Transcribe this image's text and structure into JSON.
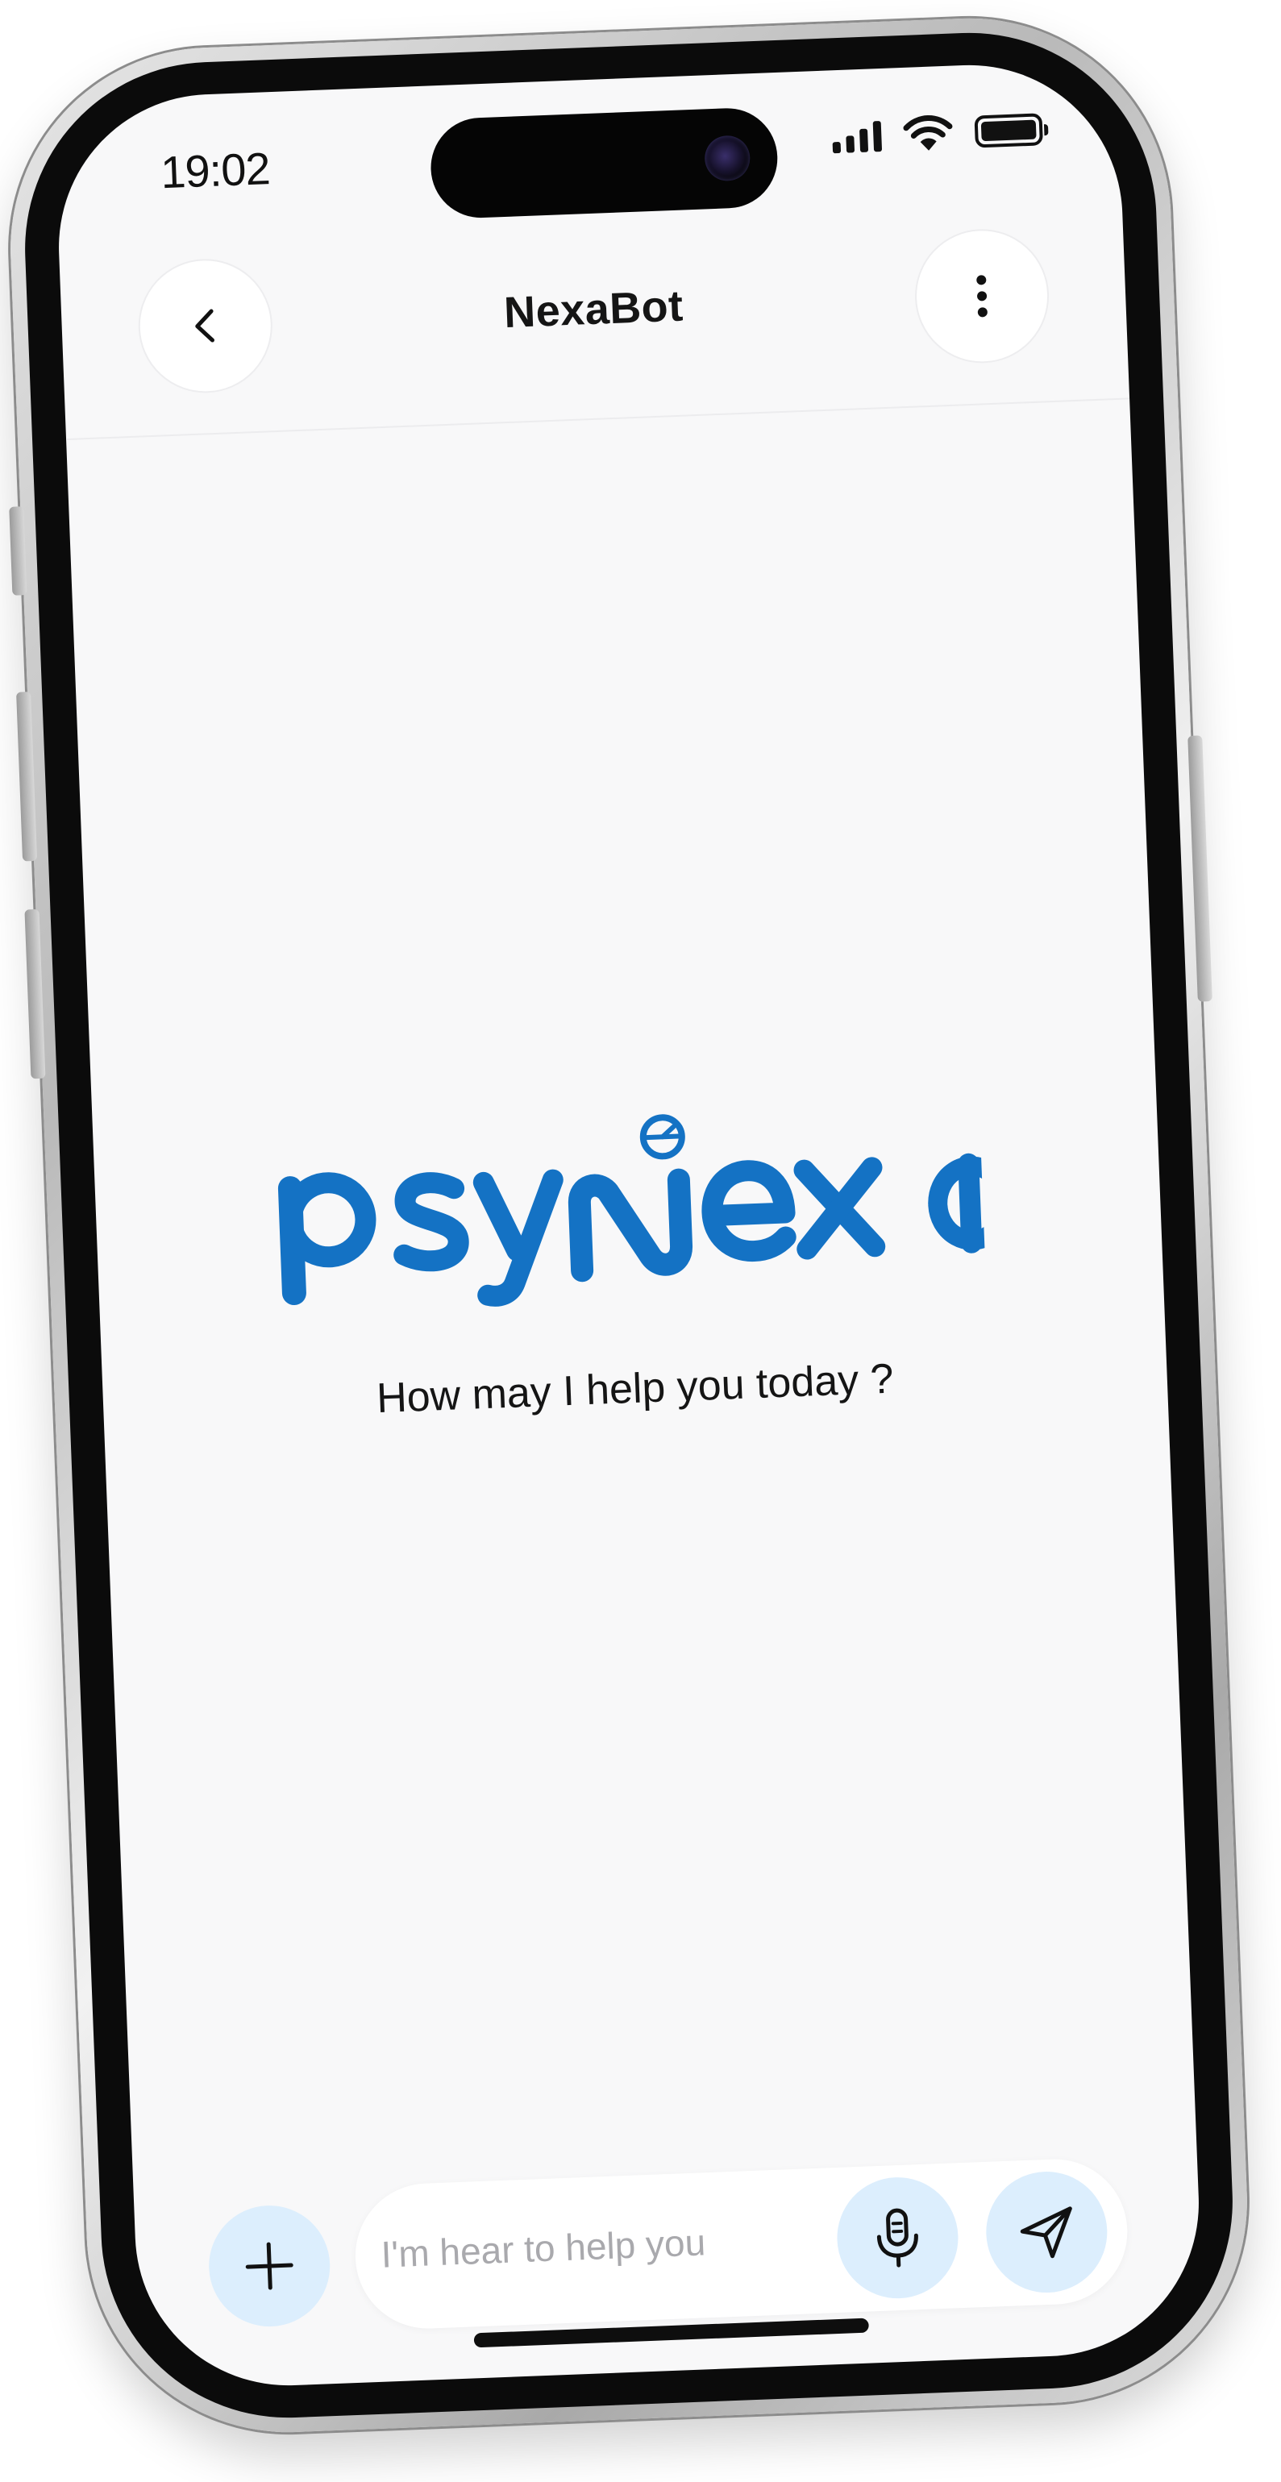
{
  "status_bar": {
    "time": "19:02",
    "icons": [
      "cellular-signal-icon",
      "wifi-icon",
      "battery-icon"
    ]
  },
  "header": {
    "title": "NexaBot",
    "back_icon": "chevron-left-icon",
    "more_icon": "vertical-dots-icon"
  },
  "brand": {
    "logo_text": "psyNexa",
    "logo_color": "#1472c4"
  },
  "main": {
    "tagline": "How may I help you today ?"
  },
  "composer": {
    "add_icon": "plus-icon",
    "placeholder": "I'm hear to help you",
    "value": "",
    "mic_icon": "microphone-icon",
    "send_icon": "send-icon",
    "button_bg": "#dceefd"
  }
}
